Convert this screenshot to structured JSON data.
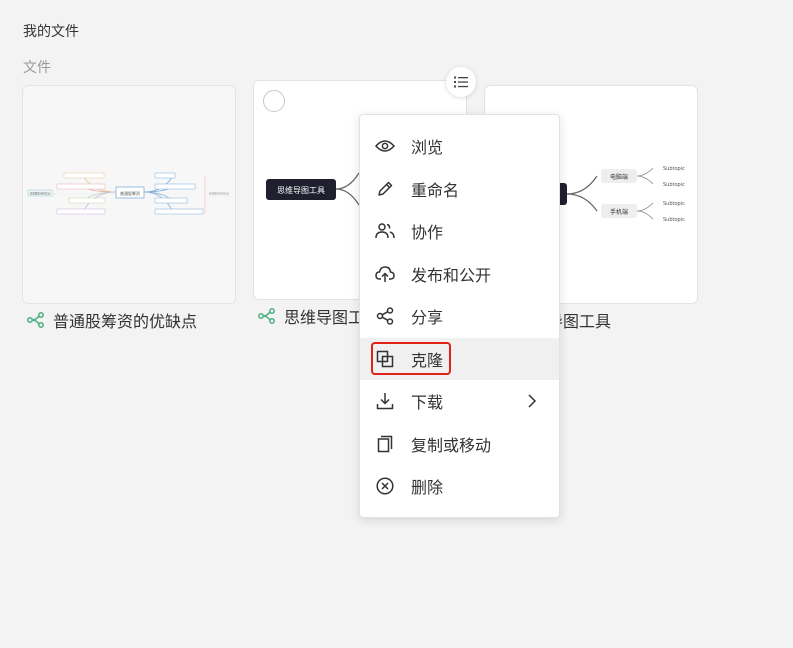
{
  "breadcrumb": "我的文件",
  "section_label": "文件",
  "cards": [
    {
      "title": "普通股筹资的优缺点",
      "thumb": {
        "center": "普通股筹资",
        "left_node": "普通股筹资的优点",
        "right_node": "普通股筹资的缺点"
      }
    },
    {
      "title": "思维导图工具",
      "thumb": {
        "center": "思维导图工具"
      }
    },
    {
      "title": "思维导图工具",
      "thumb": {
        "nodes": [
          "电脑端",
          "手机端"
        ],
        "leaves": [
          "Subtopic",
          "Subtopic",
          "Subtopic",
          "Subtopic"
        ]
      }
    }
  ],
  "menu": {
    "items": [
      {
        "label": "浏览",
        "icon": "eye-icon"
      },
      {
        "label": "重命名",
        "icon": "pencil-icon"
      },
      {
        "label": "协作",
        "icon": "people-icon"
      },
      {
        "label": "发布和公开",
        "icon": "cloud-upload-icon"
      },
      {
        "label": "分享",
        "icon": "share-icon"
      },
      {
        "label": "克隆",
        "icon": "clone-icon"
      },
      {
        "label": "下载",
        "icon": "download-icon"
      },
      {
        "label": "复制或移动",
        "icon": "copy-icon"
      },
      {
        "label": "删除",
        "icon": "close-circle-icon"
      }
    ]
  },
  "colors": {
    "accent_green": "#4caf7d",
    "highlight_red": "#e0221b",
    "dark_node": "#1f1f2e"
  }
}
